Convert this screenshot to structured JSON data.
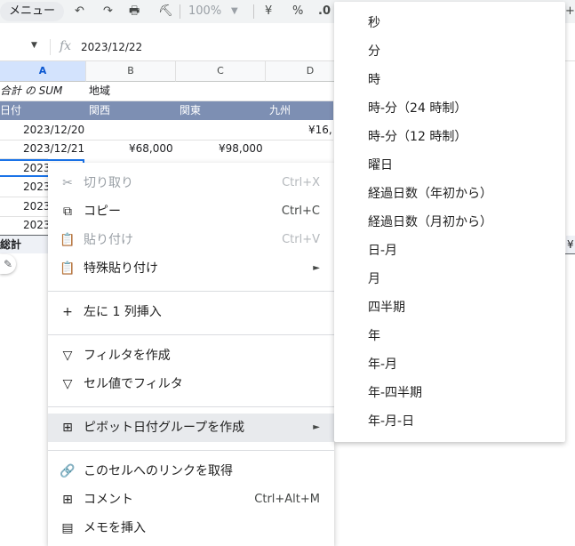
{
  "toolbar": {
    "menu_label": "メニュー",
    "zoom": "100%",
    "currency": "¥",
    "percent": "%",
    "decimal": ".0"
  },
  "name_box": {
    "value": ""
  },
  "formula": {
    "value": "2023/12/22"
  },
  "columns": [
    "A",
    "B",
    "C",
    "D"
  ],
  "pivot": {
    "corner_label": "合計 の SUM",
    "region_label": "地域",
    "date_label": "日付",
    "regions": [
      "関西",
      "関東",
      "九州"
    ],
    "rows": [
      {
        "date": "2023/12/20",
        "b": "",
        "c": "",
        "d": "¥16,"
      },
      {
        "date": "2023/12/21",
        "b": "¥68,000",
        "c": "¥98,000",
        "d": ""
      },
      {
        "date": "2023",
        "b": "",
        "c": "",
        "d": ""
      },
      {
        "date": "2023",
        "b": "",
        "c": "",
        "d": ""
      },
      {
        "date": "2023",
        "b": "",
        "c": "",
        "d": ""
      },
      {
        "date": "2023",
        "b": "",
        "c": "",
        "d": ""
      }
    ],
    "total_label": "総計",
    "total_right": "¥"
  },
  "context_menu": {
    "cut": {
      "label": "切り取り",
      "shortcut": "Ctrl+X"
    },
    "copy": {
      "label": "コピー",
      "shortcut": "Ctrl+C"
    },
    "paste": {
      "label": "貼り付け",
      "shortcut": "Ctrl+V"
    },
    "paste_special": {
      "label": "特殊貼り付け"
    },
    "insert_col": {
      "label": "左に 1 列挿入"
    },
    "create_filter": {
      "label": "フィルタを作成"
    },
    "filter_by_value": {
      "label": "セル値でフィルタ"
    },
    "pivot_group": {
      "label": "ピボット日付グループを作成"
    },
    "get_link": {
      "label": "このセルへのリンクを取得"
    },
    "comment": {
      "label": "コメント",
      "shortcut": "Ctrl+Alt+M"
    },
    "insert_note": {
      "label": "メモを挿入"
    }
  },
  "submenu": {
    "items": [
      "秒",
      "分",
      "時",
      "時-分（24 時制）",
      "時-分（12 時制）",
      "曜日",
      "経過日数（年初から）",
      "経過日数（月初から）",
      "日-月",
      "月",
      "四半期",
      "年",
      "年-月",
      "年-四半期",
      "年-月-日"
    ]
  }
}
